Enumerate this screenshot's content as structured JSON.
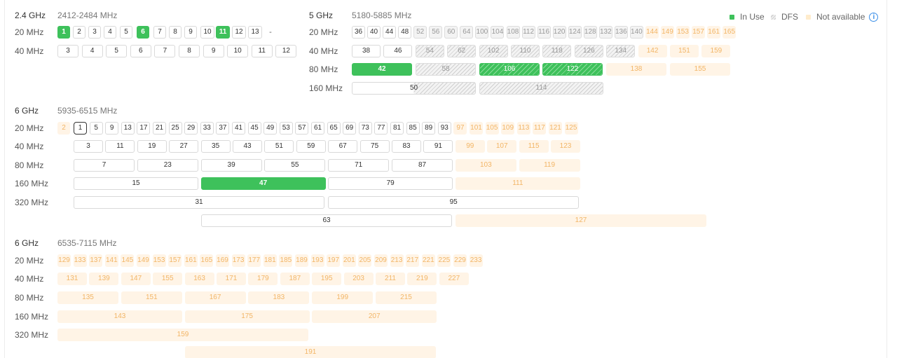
{
  "legend": {
    "in_use": "In Use",
    "dfs": "DFS",
    "na": "Not available",
    "info": "i"
  },
  "colors": {
    "in_use": "#3ec15b",
    "dfs": "#d0d0d0",
    "na": "#fff4e6",
    "na_text": "#f2b566",
    "info": "#3b8fe8"
  },
  "bands": [
    {
      "name": "2.4 GHz",
      "range": "2412-2484 MHz",
      "rows": [
        {
          "width": "20 MHz",
          "channels": [
            {
              "n": "1",
              "s": "use"
            },
            {
              "n": "2"
            },
            {
              "n": "3"
            },
            {
              "n": "4"
            },
            {
              "n": "5"
            },
            {
              "n": "6",
              "s": "use"
            },
            {
              "n": "7"
            },
            {
              "n": "8"
            },
            {
              "n": "9"
            },
            {
              "n": "10"
            },
            {
              "n": "11",
              "s": "use"
            },
            {
              "n": "12"
            },
            {
              "n": "13"
            },
            {
              "n": "-",
              "s": "dash"
            }
          ]
        },
        {
          "width": "40 MHz",
          "channels": [
            {
              "n": "3"
            },
            {
              "n": "4"
            },
            {
              "n": "5"
            },
            {
              "n": "6"
            },
            {
              "n": "7"
            },
            {
              "n": "8"
            },
            {
              "n": "9"
            },
            {
              "n": "10"
            },
            {
              "n": "11"
            },
            {
              "n": "12"
            }
          ]
        }
      ]
    },
    {
      "name": "5 GHz",
      "range": "5180-5885 MHz",
      "rows": [
        {
          "width": "20 MHz",
          "channels": [
            {
              "n": "36"
            },
            {
              "n": "40"
            },
            {
              "n": "44"
            },
            {
              "n": "48"
            },
            {
              "n": "52",
              "s": "dfs"
            },
            {
              "n": "56",
              "s": "dfs"
            },
            {
              "n": "60",
              "s": "dfs"
            },
            {
              "n": "64",
              "s": "dfs"
            },
            {
              "n": "100",
              "s": "dfs"
            },
            {
              "n": "104",
              "s": "dfs"
            },
            {
              "n": "108",
              "s": "dfs"
            },
            {
              "n": "112",
              "s": "dfs"
            },
            {
              "n": "116",
              "s": "dfs"
            },
            {
              "n": "120",
              "s": "dfs"
            },
            {
              "n": "124",
              "s": "dfs"
            },
            {
              "n": "128",
              "s": "dfs"
            },
            {
              "n": "132",
              "s": "dfs"
            },
            {
              "n": "136",
              "s": "dfs"
            },
            {
              "n": "140",
              "s": "dfs"
            },
            {
              "n": "144",
              "s": "na"
            },
            {
              "n": "149",
              "s": "na"
            },
            {
              "n": "153",
              "s": "na"
            },
            {
              "n": "157",
              "s": "na"
            },
            {
              "n": "161",
              "s": "na"
            },
            {
              "n": "165",
              "s": "na"
            }
          ]
        },
        {
          "width": "40 MHz",
          "channels": [
            {
              "n": "38"
            },
            {
              "n": "46"
            },
            {
              "n": "54",
              "s": "dfs"
            },
            {
              "n": "62",
              "s": "dfs"
            },
            {
              "n": "102",
              "s": "dfs"
            },
            {
              "n": "110",
              "s": "dfs"
            },
            {
              "n": "118",
              "s": "dfs"
            },
            {
              "n": "126",
              "s": "dfs"
            },
            {
              "n": "134",
              "s": "dfs"
            },
            {
              "n": "142",
              "s": "na"
            },
            {
              "n": "151",
              "s": "na"
            },
            {
              "n": "159",
              "s": "na"
            }
          ]
        },
        {
          "width": "80 MHz",
          "channels": [
            {
              "n": "42",
              "s": "use"
            },
            {
              "n": "58",
              "s": "dfs"
            },
            {
              "n": "106",
              "s": "usedfs"
            },
            {
              "n": "122",
              "s": "usedfs"
            },
            {
              "n": "138",
              "s": "na"
            },
            {
              "n": "155",
              "s": "na"
            }
          ]
        },
        {
          "width": "160 MHz",
          "channels": [
            {
              "n": "50",
              "s": "mixed"
            },
            {
              "n": "114",
              "s": "dfs"
            }
          ]
        }
      ]
    },
    {
      "name": "6 GHz",
      "range": "5935-6515 MHz",
      "rows": [
        {
          "width": "20 MHz",
          "channels": [
            {
              "n": "2",
              "s": "na"
            },
            {
              "n": "1",
              "s": "sel"
            },
            {
              "n": "5"
            },
            {
              "n": "9"
            },
            {
              "n": "13"
            },
            {
              "n": "17"
            },
            {
              "n": "21"
            },
            {
              "n": "25"
            },
            {
              "n": "29"
            },
            {
              "n": "33"
            },
            {
              "n": "37"
            },
            {
              "n": "41"
            },
            {
              "n": "45"
            },
            {
              "n": "49"
            },
            {
              "n": "53"
            },
            {
              "n": "57"
            },
            {
              "n": "61"
            },
            {
              "n": "65"
            },
            {
              "n": "69"
            },
            {
              "n": "73"
            },
            {
              "n": "77"
            },
            {
              "n": "81"
            },
            {
              "n": "85"
            },
            {
              "n": "89"
            },
            {
              "n": "93"
            },
            {
              "n": "97",
              "s": "na"
            },
            {
              "n": "101",
              "s": "na"
            },
            {
              "n": "105",
              "s": "na"
            },
            {
              "n": "109",
              "s": "na"
            },
            {
              "n": "113",
              "s": "na"
            },
            {
              "n": "117",
              "s": "na"
            },
            {
              "n": "121",
              "s": "na"
            },
            {
              "n": "125",
              "s": "na"
            }
          ]
        },
        {
          "width": "40 MHz",
          "channels": [
            {
              "n": "3"
            },
            {
              "n": "11"
            },
            {
              "n": "19"
            },
            {
              "n": "27"
            },
            {
              "n": "35"
            },
            {
              "n": "43"
            },
            {
              "n": "51"
            },
            {
              "n": "59"
            },
            {
              "n": "67"
            },
            {
              "n": "75"
            },
            {
              "n": "83"
            },
            {
              "n": "91"
            },
            {
              "n": "99",
              "s": "na"
            },
            {
              "n": "107",
              "s": "na"
            },
            {
              "n": "115",
              "s": "na"
            },
            {
              "n": "123",
              "s": "na"
            }
          ]
        },
        {
          "width": "80 MHz",
          "channels": [
            {
              "n": "7"
            },
            {
              "n": "23"
            },
            {
              "n": "39"
            },
            {
              "n": "55"
            },
            {
              "n": "71"
            },
            {
              "n": "87"
            },
            {
              "n": "103",
              "s": "na"
            },
            {
              "n": "119",
              "s": "na"
            }
          ]
        },
        {
          "width": "160 MHz",
          "channels": [
            {
              "n": "15"
            },
            {
              "n": "47",
              "s": "use"
            },
            {
              "n": "79"
            },
            {
              "n": "111",
              "s": "na"
            }
          ]
        },
        {
          "width": "320 MHz",
          "channels": [
            {
              "n": "31"
            },
            {
              "n": "95"
            }
          ]
        },
        {
          "width": "",
          "channels": [
            {
              "n": "63"
            },
            {
              "n": "127",
              "s": "na"
            }
          ]
        }
      ]
    },
    {
      "name": "6 GHz",
      "range": "6535-7115 MHz",
      "rows": [
        {
          "width": "20 MHz",
          "channels": [
            {
              "n": "129",
              "s": "na"
            },
            {
              "n": "133",
              "s": "na"
            },
            {
              "n": "137",
              "s": "na"
            },
            {
              "n": "141",
              "s": "na"
            },
            {
              "n": "145",
              "s": "na"
            },
            {
              "n": "149",
              "s": "na"
            },
            {
              "n": "153",
              "s": "na"
            },
            {
              "n": "157",
              "s": "na"
            },
            {
              "n": "161",
              "s": "na"
            },
            {
              "n": "165",
              "s": "na"
            },
            {
              "n": "169",
              "s": "na"
            },
            {
              "n": "173",
              "s": "na"
            },
            {
              "n": "177",
              "s": "na"
            },
            {
              "n": "181",
              "s": "na"
            },
            {
              "n": "185",
              "s": "na"
            },
            {
              "n": "189",
              "s": "na"
            },
            {
              "n": "193",
              "s": "na"
            },
            {
              "n": "197",
              "s": "na"
            },
            {
              "n": "201",
              "s": "na"
            },
            {
              "n": "205",
              "s": "na"
            },
            {
              "n": "209",
              "s": "na"
            },
            {
              "n": "213",
              "s": "na"
            },
            {
              "n": "217",
              "s": "na"
            },
            {
              "n": "221",
              "s": "na"
            },
            {
              "n": "225",
              "s": "na"
            },
            {
              "n": "229",
              "s": "na"
            },
            {
              "n": "233",
              "s": "na"
            }
          ]
        },
        {
          "width": "40 MHz",
          "channels": [
            {
              "n": "131",
              "s": "na"
            },
            {
              "n": "139",
              "s": "na"
            },
            {
              "n": "147",
              "s": "na"
            },
            {
              "n": "155",
              "s": "na"
            },
            {
              "n": "163",
              "s": "na"
            },
            {
              "n": "171",
              "s": "na"
            },
            {
              "n": "179",
              "s": "na"
            },
            {
              "n": "187",
              "s": "na"
            },
            {
              "n": "195",
              "s": "na"
            },
            {
              "n": "203",
              "s": "na"
            },
            {
              "n": "211",
              "s": "na"
            },
            {
              "n": "219",
              "s": "na"
            },
            {
              "n": "227",
              "s": "na"
            }
          ]
        },
        {
          "width": "80 MHz",
          "channels": [
            {
              "n": "135",
              "s": "na"
            },
            {
              "n": "151",
              "s": "na"
            },
            {
              "n": "167",
              "s": "na"
            },
            {
              "n": "183",
              "s": "na"
            },
            {
              "n": "199",
              "s": "na"
            },
            {
              "n": "215",
              "s": "na"
            }
          ]
        },
        {
          "width": "160 MHz",
          "channels": [
            {
              "n": "143",
              "s": "na"
            },
            {
              "n": "175",
              "s": "na"
            },
            {
              "n": "207",
              "s": "na"
            }
          ]
        },
        {
          "width": "320 MHz",
          "channels": [
            {
              "n": "159",
              "s": "na"
            }
          ]
        },
        {
          "width": "",
          "channels": [
            {
              "n": "191",
              "s": "na"
            }
          ]
        }
      ]
    }
  ]
}
